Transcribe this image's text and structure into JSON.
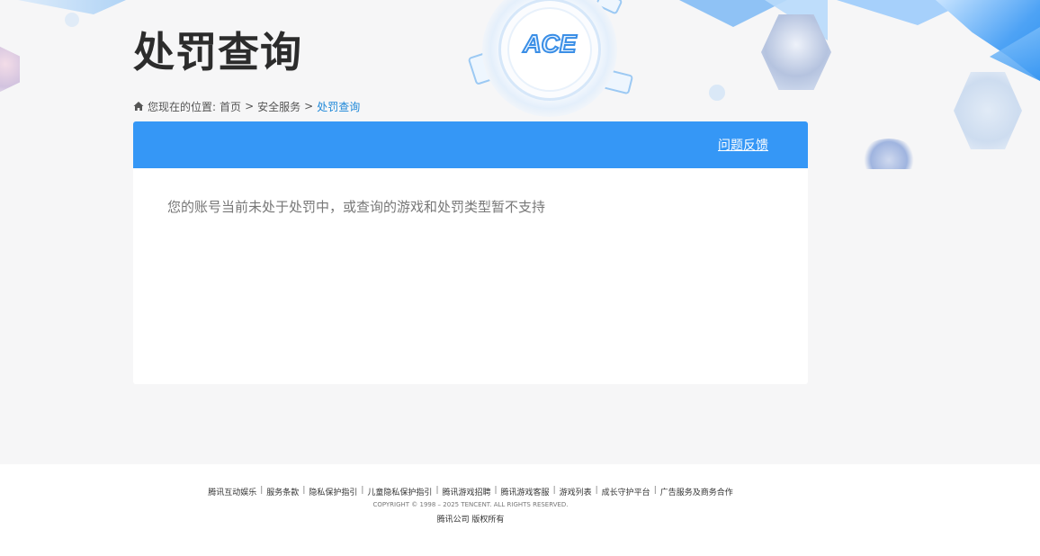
{
  "page": {
    "title": "处罚查询"
  },
  "breadcrumb": {
    "icon": "home-icon",
    "prefix": "您现在的位置:",
    "separator": ">",
    "items": [
      "首页",
      "安全服务",
      "处罚查询"
    ]
  },
  "logo": {
    "text": "ACE"
  },
  "panel": {
    "header_color": "#3597f6",
    "feedback_link": "问题反馈",
    "message": "您的账号当前未处于处罚中，或查询的游戏和处罚类型暂不支持"
  },
  "footer": {
    "links": [
      "腾讯互动娱乐",
      "服务条款",
      "隐私保护指引",
      "儿童隐私保护指引",
      "腾讯游戏招聘",
      "腾讯游戏客服",
      "游戏列表",
      "成长守护平台",
      "广告服务及商务合作"
    ],
    "link_separator": "|",
    "copyright": "COPYRIGHT © 1998 – 2025 TENCENT. ALL RIGHTS RESERVED.",
    "company": "腾讯公司 版权所有"
  }
}
